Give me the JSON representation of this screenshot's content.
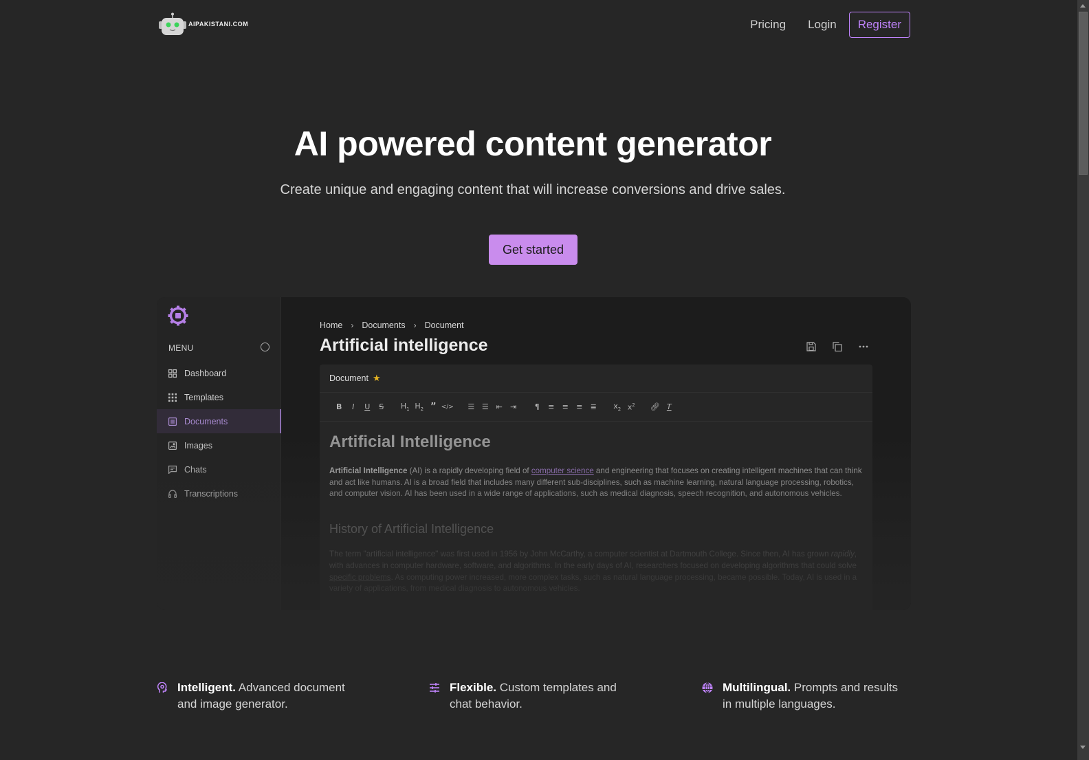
{
  "header": {
    "logo_text": "AIPAKISTANI.COM",
    "nav": {
      "pricing": "Pricing",
      "login": "Login",
      "register": "Register"
    }
  },
  "hero": {
    "title": "AI powered content generator",
    "subtitle": "Create unique and engaging content that will increase conversions and drive sales.",
    "cta": "Get started"
  },
  "preview": {
    "sidebar": {
      "menu_label": "MENU",
      "items": [
        {
          "label": "Dashboard",
          "icon": "dashboard-icon",
          "active": false
        },
        {
          "label": "Templates",
          "icon": "grid-dots-icon",
          "active": false
        },
        {
          "label": "Documents",
          "icon": "document-icon",
          "active": true
        },
        {
          "label": "Images",
          "icon": "image-icon",
          "active": false
        },
        {
          "label": "Chats",
          "icon": "chat-icon",
          "active": false
        },
        {
          "label": "Transcriptions",
          "icon": "headphones-icon",
          "active": false
        }
      ]
    },
    "breadcrumb": [
      "Home",
      "Documents",
      "Document"
    ],
    "title": "Artificial intelligence",
    "editor": {
      "header_label": "Document",
      "toolbar": [
        "B",
        "I",
        "U",
        "S",
        "H1",
        "H2",
        "quote",
        "code",
        "ordered-list",
        "bullet-list",
        "outdent",
        "indent",
        "text-direction",
        "align-left",
        "align-center",
        "align-right",
        "justify",
        "subscript",
        "superscript",
        "link",
        "clear-format"
      ],
      "heading": "Artificial Intelligence",
      "para1_bold": "Artificial Intelligence",
      "para1_a": " (AI) is a rapidly developing field of ",
      "para1_link": "computer science",
      "para1_b": " and engineering that focuses on creating intelligent machines that can think and act like humans. AI is a broad field that includes many different sub-disciplines, such as machine learning, natural language processing, robotics, and computer vision. AI has been used in a wide range of applications, such as medical diagnosis, speech recognition, and autonomous vehicles.",
      "subheading": "History of Artificial Intelligence",
      "para2_a": "The term \"artificial intelligence\" was first used in 1956 by John McCarthy, a computer scientist at Dartmouth College. Since then, AI has grown ",
      "para2_italic": "rapidly",
      "para2_b": ", with advances in computer hardware, software, and algorithms. In the early days of AI, researchers focused on developing algorithms that could solve ",
      "para2_link": "specific problems",
      "para2_c": ". As computing power increased, more complex tasks, such as natural language processing, became possible. Today, AI is used in a variety of applications, from medical diagnosis to autonomous vehicles."
    }
  },
  "features": [
    {
      "title": "Intelligent.",
      "text": " Advanced document and image generator.",
      "icon": "brain-icon"
    },
    {
      "title": "Flexible.",
      "text": " Custom templates and chat behavior.",
      "icon": "sliders-icon"
    },
    {
      "title": "Multilingual.",
      "text": " Prompts and results in multiple languages.",
      "icon": "globe-icon"
    }
  ],
  "colors": {
    "accent": "#c98ced",
    "register_border": "#c084fc",
    "background": "#262626",
    "star": "#e6b422"
  }
}
